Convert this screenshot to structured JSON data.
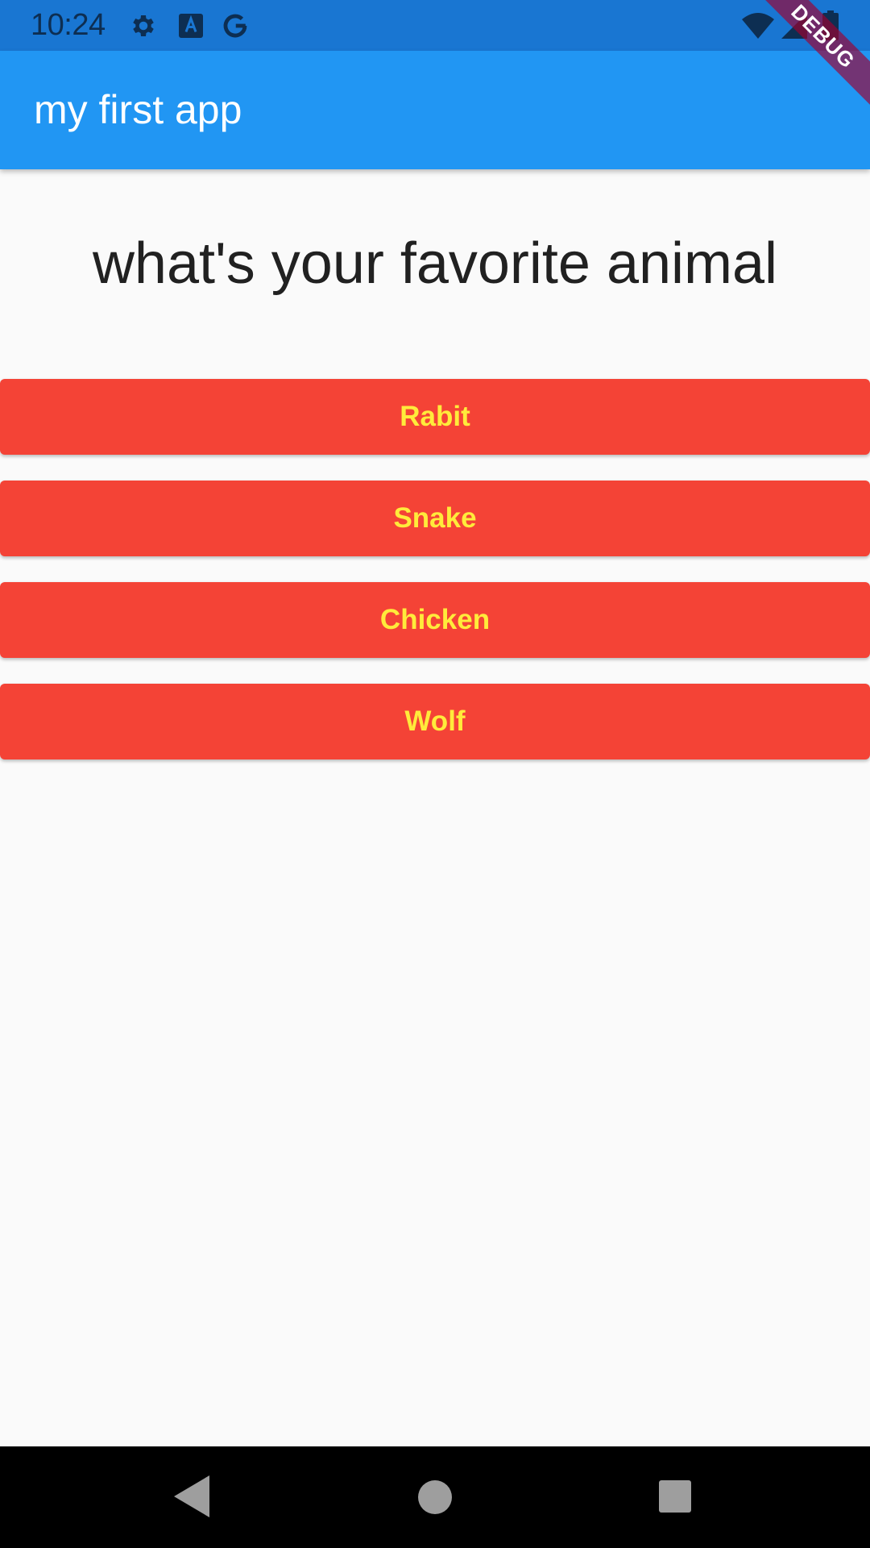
{
  "status_bar": {
    "time": "10:24",
    "left_icons": [
      "gear-icon",
      "a-text-icon",
      "google-g-icon"
    ],
    "right_icons": [
      "wifi-icon",
      "signal-icon",
      "battery-icon"
    ]
  },
  "app_bar": {
    "title": "my first app",
    "color": "#2196f3"
  },
  "debug_banner": "DEBUG",
  "question": "what's your favorite animal",
  "answers": [
    {
      "label": "Rabit"
    },
    {
      "label": "Snake"
    },
    {
      "label": "Chicken"
    },
    {
      "label": "Wolf"
    }
  ],
  "colors": {
    "button_bg": "#f44336",
    "button_text": "#ffeb3b",
    "status_bar": "#1976d2"
  },
  "nav_bar": {
    "buttons": [
      "back-icon",
      "home-icon",
      "recents-icon"
    ]
  }
}
